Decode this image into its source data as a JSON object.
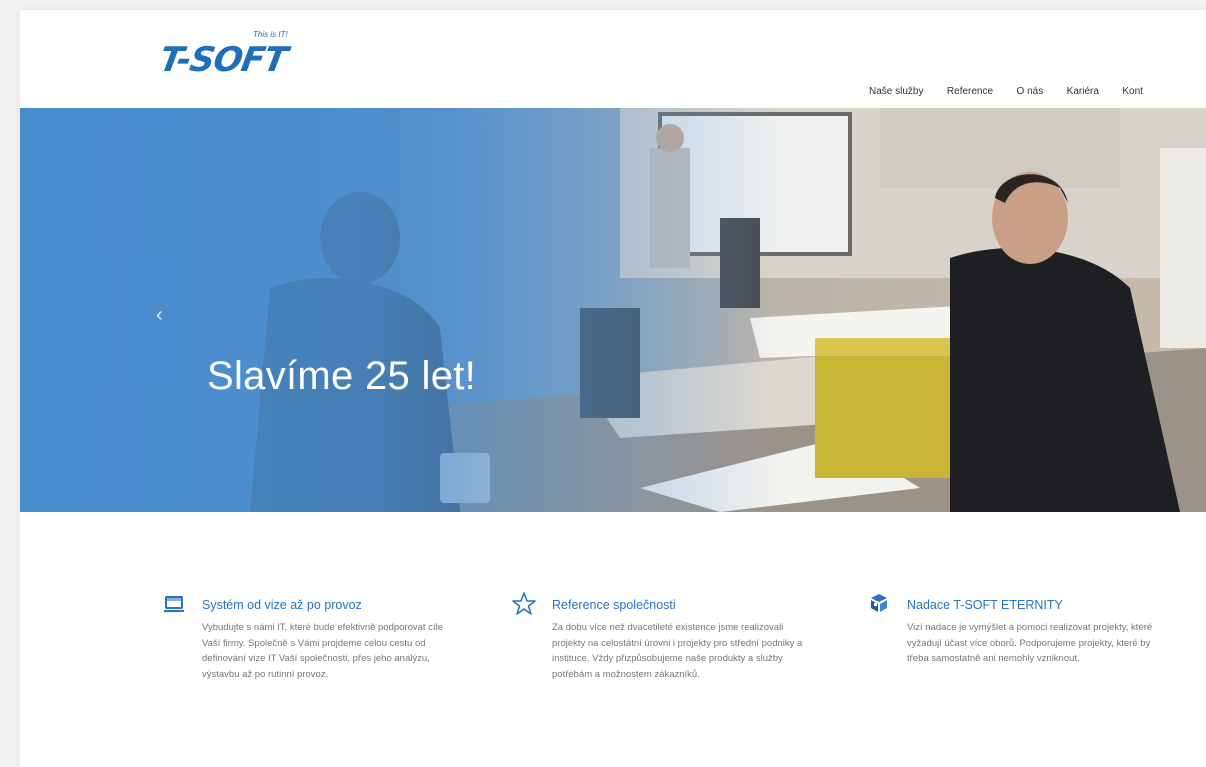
{
  "brand": {
    "logo_text": "T-SOFT",
    "tagline": "This is IT!"
  },
  "nav": {
    "items": [
      {
        "label": "Naše služby"
      },
      {
        "label": "Reference"
      },
      {
        "label": "O nás"
      },
      {
        "label": "Kariéra"
      },
      {
        "label": "Kont"
      }
    ]
  },
  "hero": {
    "title": "Slavíme 25 let!",
    "prev_label": "‹"
  },
  "features": [
    {
      "icon": "monitor-icon",
      "title": "Systém od vize až po provoz",
      "text": "Vybudujte s námi IT, které bude efektivně podporovat cíle Vaší firmy. Společně s Vámi projdeme celou cestu od definování vize IT Vaší společnosti, přes jeho analýzu, výstavbu až po rutinní provoz."
    },
    {
      "icon": "star-icon",
      "title": "Reference společnosti",
      "text": "Za dobu více než dvacetileté existence jsme realizovali projekty na celostátní úrovni i projekty pro střední podniky a instituce. Vždy přizpůsobujeme naše produkty a služby potřebám a možnostem zákazníků."
    },
    {
      "icon": "cubes-icon",
      "title": "Nadace T-SOFT ETERNITY",
      "text": "Vizí nadace je vymýšlet a pomoci realizovat projekty, které vyžadují účast více oborů. Podporujeme projekty, které by třeba samostatně ani nemohly vzniknout."
    }
  ],
  "colors": {
    "accent": "#2a73c2",
    "hero_blue": "#4e8fcd",
    "logo": "#1d6fb8"
  }
}
